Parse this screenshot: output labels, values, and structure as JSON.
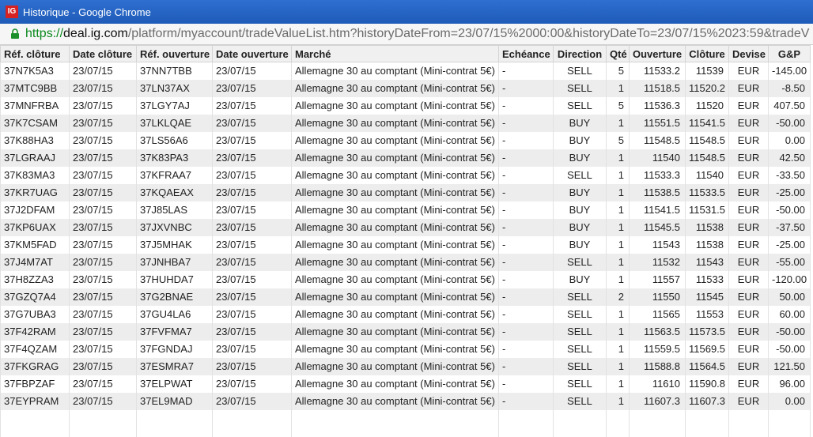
{
  "window": {
    "title": "Historique - Google Chrome",
    "icon_text": "IG"
  },
  "address": {
    "scheme": "https://",
    "host": "deal.ig.com",
    "rest": "/platform/myaccount/tradeValueList.htm?historyDateFrom=23/07/15%2000:00&historyDateTo=23/07/15%2023:59&tradeV"
  },
  "table": {
    "headers": [
      "Réf. clôture",
      "Date clôture",
      "Réf. ouverture",
      "Date ouverture",
      "Marché",
      "Echéance",
      "Direction",
      "Qté",
      "Ouverture",
      "Clôture",
      "Devise",
      "G&P"
    ],
    "rows": [
      [
        "37N7K5A3",
        "23/07/15",
        "37NN7TBB",
        "23/07/15",
        "Allemagne 30 au comptant (Mini-contrat 5€)",
        "-",
        "SELL",
        "5",
        "11533.2",
        "11539",
        "EUR",
        "-145.00"
      ],
      [
        "37MTC9BB",
        "23/07/15",
        "37LN37AX",
        "23/07/15",
        "Allemagne 30 au comptant (Mini-contrat 5€)",
        "-",
        "SELL",
        "1",
        "11518.5",
        "11520.2",
        "EUR",
        "-8.50"
      ],
      [
        "37MNFRBA",
        "23/07/15",
        "37LGY7AJ",
        "23/07/15",
        "Allemagne 30 au comptant (Mini-contrat 5€)",
        "-",
        "SELL",
        "5",
        "11536.3",
        "11520",
        "EUR",
        "407.50"
      ],
      [
        "37K7CSAM",
        "23/07/15",
        "37LKLQAE",
        "23/07/15",
        "Allemagne 30 au comptant (Mini-contrat 5€)",
        "-",
        "BUY",
        "1",
        "11551.5",
        "11541.5",
        "EUR",
        "-50.00"
      ],
      [
        "37K88HA3",
        "23/07/15",
        "37LS56A6",
        "23/07/15",
        "Allemagne 30 au comptant (Mini-contrat 5€)",
        "-",
        "BUY",
        "5",
        "11548.5",
        "11548.5",
        "EUR",
        "0.00"
      ],
      [
        "37LGRAAJ",
        "23/07/15",
        "37K83PA3",
        "23/07/15",
        "Allemagne 30 au comptant (Mini-contrat 5€)",
        "-",
        "BUY",
        "1",
        "11540",
        "11548.5",
        "EUR",
        "42.50"
      ],
      [
        "37K83MA3",
        "23/07/15",
        "37KFRAA7",
        "23/07/15",
        "Allemagne 30 au comptant (Mini-contrat 5€)",
        "-",
        "SELL",
        "1",
        "11533.3",
        "11540",
        "EUR",
        "-33.50"
      ],
      [
        "37KR7UAG",
        "23/07/15",
        "37KQAEAX",
        "23/07/15",
        "Allemagne 30 au comptant (Mini-contrat 5€)",
        "-",
        "BUY",
        "1",
        "11538.5",
        "11533.5",
        "EUR",
        "-25.00"
      ],
      [
        "37J2DFAM",
        "23/07/15",
        "37J85LAS",
        "23/07/15",
        "Allemagne 30 au comptant (Mini-contrat 5€)",
        "-",
        "BUY",
        "1",
        "11541.5",
        "11531.5",
        "EUR",
        "-50.00"
      ],
      [
        "37KP6UAX",
        "23/07/15",
        "37JXVNBC",
        "23/07/15",
        "Allemagne 30 au comptant (Mini-contrat 5€)",
        "-",
        "BUY",
        "1",
        "11545.5",
        "11538",
        "EUR",
        "-37.50"
      ],
      [
        "37KM5FAD",
        "23/07/15",
        "37J5MHAK",
        "23/07/15",
        "Allemagne 30 au comptant (Mini-contrat 5€)",
        "-",
        "BUY",
        "1",
        "11543",
        "11538",
        "EUR",
        "-25.00"
      ],
      [
        "37J4M7AT",
        "23/07/15",
        "37JNHBA7",
        "23/07/15",
        "Allemagne 30 au comptant (Mini-contrat 5€)",
        "-",
        "SELL",
        "1",
        "11532",
        "11543",
        "EUR",
        "-55.00"
      ],
      [
        "37H8ZZA3",
        "23/07/15",
        "37HUHDA7",
        "23/07/15",
        "Allemagne 30 au comptant (Mini-contrat 5€)",
        "-",
        "BUY",
        "1",
        "11557",
        "11533",
        "EUR",
        "-120.00"
      ],
      [
        "37GZQ7A4",
        "23/07/15",
        "37G2BNAE",
        "23/07/15",
        "Allemagne 30 au comptant (Mini-contrat 5€)",
        "-",
        "SELL",
        "2",
        "11550",
        "11545",
        "EUR",
        "50.00"
      ],
      [
        "37G7UBA3",
        "23/07/15",
        "37GU4LA6",
        "23/07/15",
        "Allemagne 30 au comptant (Mini-contrat 5€)",
        "-",
        "SELL",
        "1",
        "11565",
        "11553",
        "EUR",
        "60.00"
      ],
      [
        "37F42RAM",
        "23/07/15",
        "37FVFMA7",
        "23/07/15",
        "Allemagne 30 au comptant (Mini-contrat 5€)",
        "-",
        "SELL",
        "1",
        "11563.5",
        "11573.5",
        "EUR",
        "-50.00"
      ],
      [
        "37F4QZAM",
        "23/07/15",
        "37FGNDAJ",
        "23/07/15",
        "Allemagne 30 au comptant (Mini-contrat 5€)",
        "-",
        "SELL",
        "1",
        "11559.5",
        "11569.5",
        "EUR",
        "-50.00"
      ],
      [
        "37FKGRAG",
        "23/07/15",
        "37ESMRA7",
        "23/07/15",
        "Allemagne 30 au comptant (Mini-contrat 5€)",
        "-",
        "SELL",
        "1",
        "11588.8",
        "11564.5",
        "EUR",
        "121.50"
      ],
      [
        "37FBPZAF",
        "23/07/15",
        "37ELPWAT",
        "23/07/15",
        "Allemagne 30 au comptant (Mini-contrat 5€)",
        "-",
        "SELL",
        "1",
        "11610",
        "11590.8",
        "EUR",
        "96.00"
      ],
      [
        "37EYPRAM",
        "23/07/15",
        "37EL9MAD",
        "23/07/15",
        "Allemagne 30 au comptant (Mini-contrat 5€)",
        "-",
        "SELL",
        "1",
        "11607.3",
        "11607.3",
        "EUR",
        "0.00"
      ]
    ]
  }
}
